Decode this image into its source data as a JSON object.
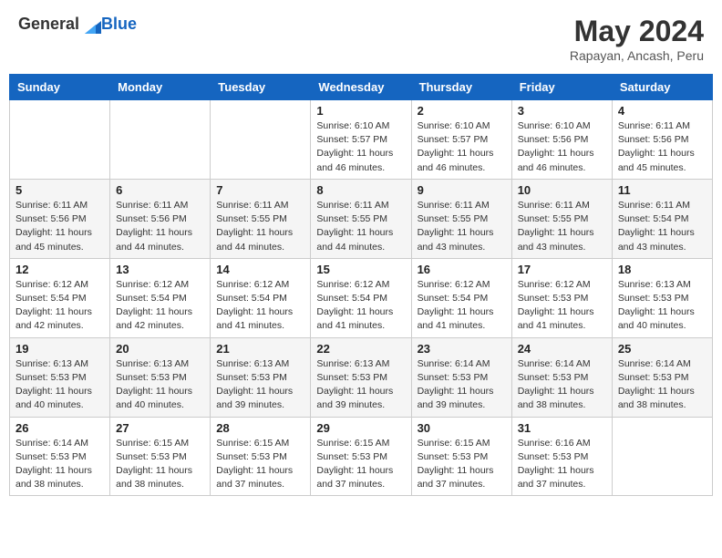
{
  "logo": {
    "general": "General",
    "blue": "Blue"
  },
  "title": "May 2024",
  "subtitle": "Rapayan, Ancash, Peru",
  "weekdays": [
    "Sunday",
    "Monday",
    "Tuesday",
    "Wednesday",
    "Thursday",
    "Friday",
    "Saturday"
  ],
  "weeks": [
    [
      {
        "day": "",
        "info": ""
      },
      {
        "day": "",
        "info": ""
      },
      {
        "day": "",
        "info": ""
      },
      {
        "day": "1",
        "info": "Sunrise: 6:10 AM\nSunset: 5:57 PM\nDaylight: 11 hours\nand 46 minutes."
      },
      {
        "day": "2",
        "info": "Sunrise: 6:10 AM\nSunset: 5:57 PM\nDaylight: 11 hours\nand 46 minutes."
      },
      {
        "day": "3",
        "info": "Sunrise: 6:10 AM\nSunset: 5:56 PM\nDaylight: 11 hours\nand 46 minutes."
      },
      {
        "day": "4",
        "info": "Sunrise: 6:11 AM\nSunset: 5:56 PM\nDaylight: 11 hours\nand 45 minutes."
      }
    ],
    [
      {
        "day": "5",
        "info": "Sunrise: 6:11 AM\nSunset: 5:56 PM\nDaylight: 11 hours\nand 45 minutes."
      },
      {
        "day": "6",
        "info": "Sunrise: 6:11 AM\nSunset: 5:56 PM\nDaylight: 11 hours\nand 44 minutes."
      },
      {
        "day": "7",
        "info": "Sunrise: 6:11 AM\nSunset: 5:55 PM\nDaylight: 11 hours\nand 44 minutes."
      },
      {
        "day": "8",
        "info": "Sunrise: 6:11 AM\nSunset: 5:55 PM\nDaylight: 11 hours\nand 44 minutes."
      },
      {
        "day": "9",
        "info": "Sunrise: 6:11 AM\nSunset: 5:55 PM\nDaylight: 11 hours\nand 43 minutes."
      },
      {
        "day": "10",
        "info": "Sunrise: 6:11 AM\nSunset: 5:55 PM\nDaylight: 11 hours\nand 43 minutes."
      },
      {
        "day": "11",
        "info": "Sunrise: 6:11 AM\nSunset: 5:54 PM\nDaylight: 11 hours\nand 43 minutes."
      }
    ],
    [
      {
        "day": "12",
        "info": "Sunrise: 6:12 AM\nSunset: 5:54 PM\nDaylight: 11 hours\nand 42 minutes."
      },
      {
        "day": "13",
        "info": "Sunrise: 6:12 AM\nSunset: 5:54 PM\nDaylight: 11 hours\nand 42 minutes."
      },
      {
        "day": "14",
        "info": "Sunrise: 6:12 AM\nSunset: 5:54 PM\nDaylight: 11 hours\nand 41 minutes."
      },
      {
        "day": "15",
        "info": "Sunrise: 6:12 AM\nSunset: 5:54 PM\nDaylight: 11 hours\nand 41 minutes."
      },
      {
        "day": "16",
        "info": "Sunrise: 6:12 AM\nSunset: 5:54 PM\nDaylight: 11 hours\nand 41 minutes."
      },
      {
        "day": "17",
        "info": "Sunrise: 6:12 AM\nSunset: 5:53 PM\nDaylight: 11 hours\nand 41 minutes."
      },
      {
        "day": "18",
        "info": "Sunrise: 6:13 AM\nSunset: 5:53 PM\nDaylight: 11 hours\nand 40 minutes."
      }
    ],
    [
      {
        "day": "19",
        "info": "Sunrise: 6:13 AM\nSunset: 5:53 PM\nDaylight: 11 hours\nand 40 minutes."
      },
      {
        "day": "20",
        "info": "Sunrise: 6:13 AM\nSunset: 5:53 PM\nDaylight: 11 hours\nand 40 minutes."
      },
      {
        "day": "21",
        "info": "Sunrise: 6:13 AM\nSunset: 5:53 PM\nDaylight: 11 hours\nand 39 minutes."
      },
      {
        "day": "22",
        "info": "Sunrise: 6:13 AM\nSunset: 5:53 PM\nDaylight: 11 hours\nand 39 minutes."
      },
      {
        "day": "23",
        "info": "Sunrise: 6:14 AM\nSunset: 5:53 PM\nDaylight: 11 hours\nand 39 minutes."
      },
      {
        "day": "24",
        "info": "Sunrise: 6:14 AM\nSunset: 5:53 PM\nDaylight: 11 hours\nand 38 minutes."
      },
      {
        "day": "25",
        "info": "Sunrise: 6:14 AM\nSunset: 5:53 PM\nDaylight: 11 hours\nand 38 minutes."
      }
    ],
    [
      {
        "day": "26",
        "info": "Sunrise: 6:14 AM\nSunset: 5:53 PM\nDaylight: 11 hours\nand 38 minutes."
      },
      {
        "day": "27",
        "info": "Sunrise: 6:15 AM\nSunset: 5:53 PM\nDaylight: 11 hours\nand 38 minutes."
      },
      {
        "day": "28",
        "info": "Sunrise: 6:15 AM\nSunset: 5:53 PM\nDaylight: 11 hours\nand 37 minutes."
      },
      {
        "day": "29",
        "info": "Sunrise: 6:15 AM\nSunset: 5:53 PM\nDaylight: 11 hours\nand 37 minutes."
      },
      {
        "day": "30",
        "info": "Sunrise: 6:15 AM\nSunset: 5:53 PM\nDaylight: 11 hours\nand 37 minutes."
      },
      {
        "day": "31",
        "info": "Sunrise: 6:16 AM\nSunset: 5:53 PM\nDaylight: 11 hours\nand 37 minutes."
      },
      {
        "day": "",
        "info": ""
      }
    ]
  ]
}
